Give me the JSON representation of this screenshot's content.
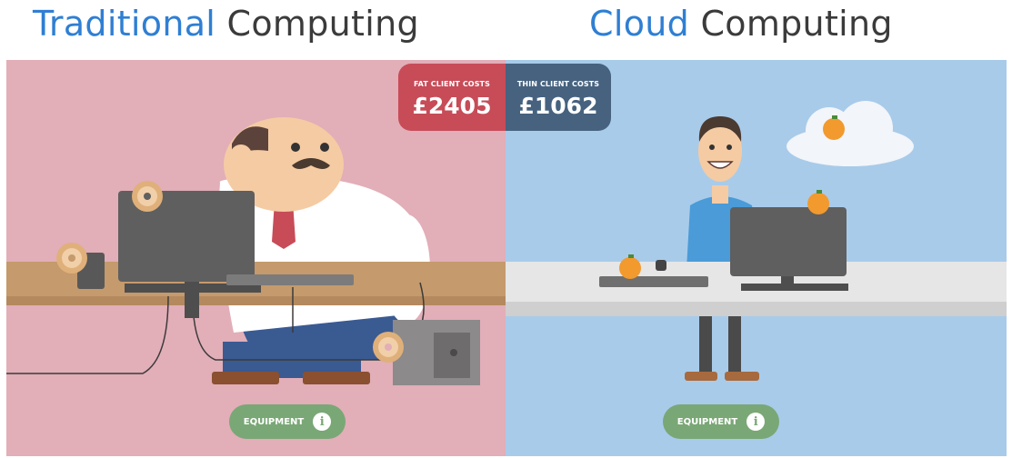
{
  "titles": {
    "left": {
      "highlight": "Traditional",
      "rest": "Computing"
    },
    "right": {
      "highlight": "Cloud",
      "rest": "Computing"
    }
  },
  "costs": {
    "fat": {
      "label": "FAT CLIENT COSTS",
      "amount": "£2405"
    },
    "thin": {
      "label": "THIN CLIENT COSTS",
      "amount": "£1062"
    }
  },
  "equipment_buttons": {
    "left": {
      "label": "EQUIPMENT",
      "icon": "info-icon"
    },
    "right": {
      "label": "EQUIPMENT",
      "icon": "info-icon"
    }
  },
  "colors": {
    "traditional_bg": "#e2aeb8",
    "cloud_bg": "#a8cbea",
    "fat_badge": "#c74c58",
    "thin_badge": "#46627f",
    "equipment_button": "#7aa776",
    "title_accent": "#2f7fd3"
  }
}
